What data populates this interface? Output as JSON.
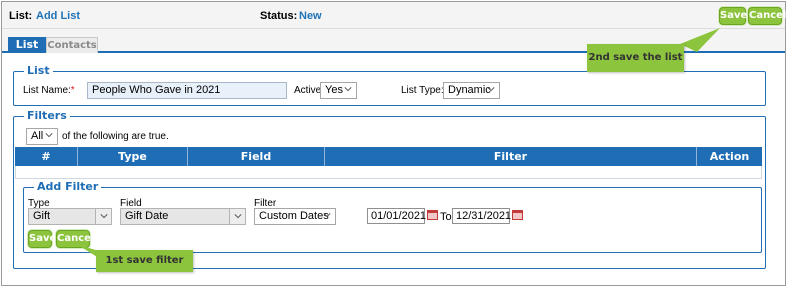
{
  "header": {
    "list_label": "List:",
    "list_value": "Add List",
    "status_label": "Status:",
    "status_value": "New",
    "save_label": "Save",
    "cancel_label": "Cancel"
  },
  "tabs": [
    {
      "label": "List",
      "active": true
    },
    {
      "label": "Contacts",
      "active": false
    }
  ],
  "list_section": {
    "legend": "List",
    "name_label": "List Name:",
    "required_mark": "*",
    "name_value": "People Who Gave in 2021",
    "active_label": "Active:",
    "active_value": "Yes",
    "type_label": "List Type:",
    "type_value": "Dynamic"
  },
  "filters_section": {
    "legend": "Filters",
    "match_value": "All",
    "match_text": "of the following are true.",
    "columns": [
      "#",
      "Type",
      "Field",
      "Filter",
      "Action"
    ]
  },
  "add_filter": {
    "legend": "Add Filter",
    "type_label": "Type",
    "type_value": "Gift",
    "field_label": "Field",
    "field_value": "Gift Date",
    "filter_label": "Filter",
    "filter_value": "Custom Dates",
    "date_from": "01/01/2021",
    "to_label": "To",
    "date_to": "12/31/2021",
    "save_label": "Save",
    "cancel_label": "Cancel"
  },
  "callouts": {
    "top": "2nd save the list",
    "bottom": "1st save filter"
  },
  "colors": {
    "accent_blue": "#1f6eb5",
    "link_blue": "#1f73b7",
    "button_green": "#8cc43d",
    "required_red": "#d02020"
  }
}
